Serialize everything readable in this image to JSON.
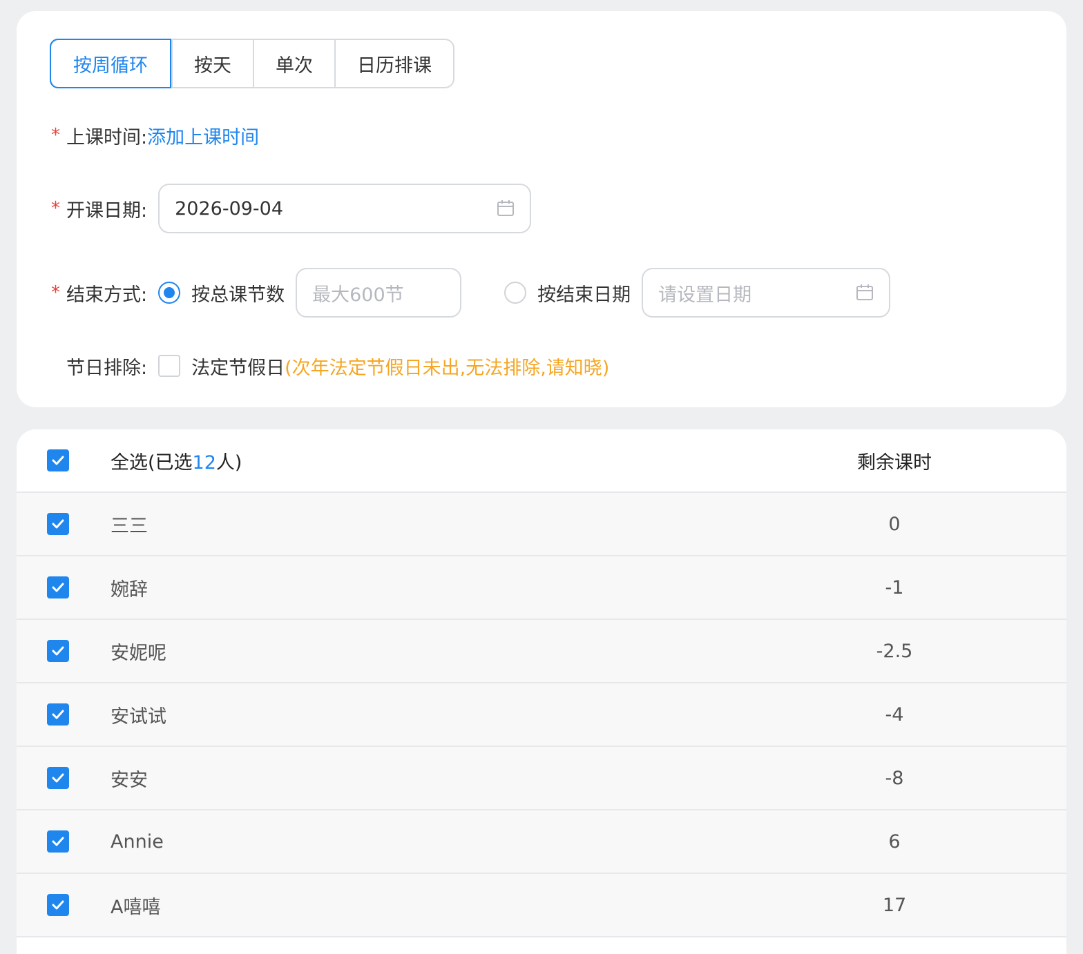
{
  "tabs": [
    {
      "label": "按周循环",
      "active": true
    },
    {
      "label": "按天",
      "active": false
    },
    {
      "label": "单次",
      "active": false
    },
    {
      "label": "日历排课",
      "active": false
    }
  ],
  "form": {
    "class_time": {
      "required_mark": "*",
      "label": "上课时间:",
      "link": "添加上课时间"
    },
    "start_date": {
      "required_mark": "*",
      "label": "开课日期:",
      "value": "2026-09-04",
      "icon": "calendar-icon"
    },
    "end_mode": {
      "required_mark": "*",
      "label": "结束方式:",
      "option_count": {
        "label": "按总课节数",
        "placeholder": "最大600节",
        "selected": true
      },
      "option_date": {
        "label": "按结束日期",
        "placeholder": "请设置日期",
        "selected": false
      }
    },
    "holiday": {
      "label": "节日排除:",
      "checkbox_label": "法定节假日",
      "checked": false,
      "notice": "(次年法定节假日未出,无法排除,请知晓)"
    }
  },
  "table": {
    "header": {
      "select_all_prefix": "全选(已选",
      "selected_count": "12",
      "select_all_suffix": "人)",
      "remaining_label": "剩余课时"
    },
    "rows": [
      {
        "name": "三三",
        "remaining": "0"
      },
      {
        "name": "婉辞",
        "remaining": "-1"
      },
      {
        "name": "安妮呢",
        "remaining": "-2.5"
      },
      {
        "name": "安试试",
        "remaining": "-4"
      },
      {
        "name": "安安",
        "remaining": "-8"
      },
      {
        "name": "Annie",
        "remaining": "6"
      },
      {
        "name": "A嘻嘻",
        "remaining": "17"
      }
    ]
  },
  "colors": {
    "accent": "#1f86ee",
    "required": "#e8413c",
    "warning": "#f5a623"
  }
}
